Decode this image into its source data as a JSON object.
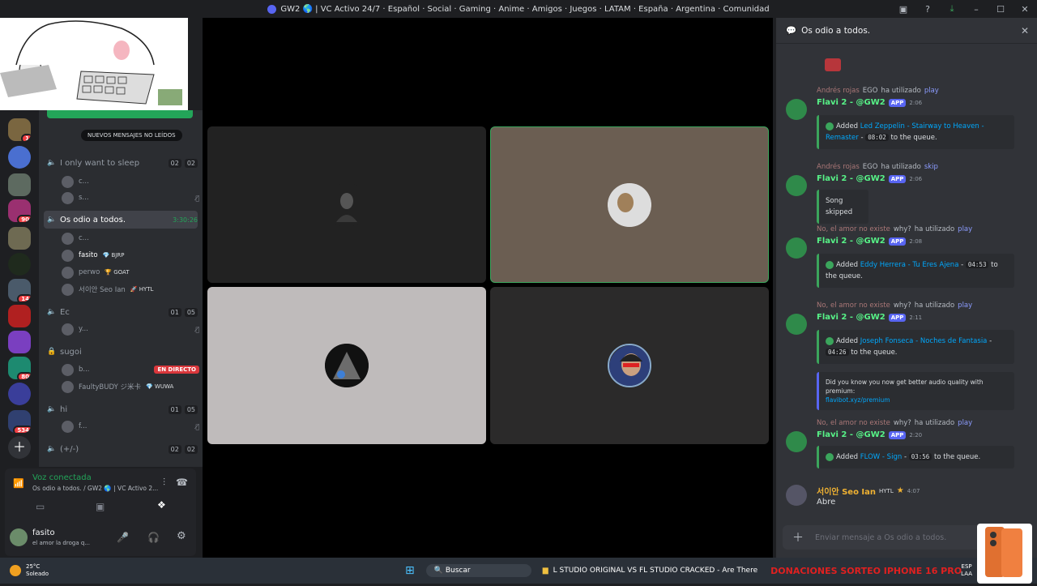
{
  "window": {
    "title": "GW2 🌎 | VC Activo 24/7 · Español · Social · Gaming · Anime · Amigos · Juegos · LATAM · España · Argentina · Comunidad"
  },
  "guild_badges": [
    "1",
    "90",
    "14",
    "80",
    "534"
  ],
  "channels": {
    "new_messages": "NUEVOS MENSAJES NO LEÍDOS",
    "list": [
      {
        "name": "I only want to sleep",
        "count_a": "02",
        "count_b": "02"
      },
      {
        "name": "Os odio a todos.",
        "timer": "3:30:26"
      },
      {
        "name": "Ec",
        "count_a": "01",
        "count_b": "05"
      },
      {
        "name": "sugoi"
      },
      {
        "name": "hi",
        "count_a": "01",
        "count_b": "05"
      },
      {
        "name": "(+/-)",
        "count_a": "02",
        "count_b": "02"
      }
    ],
    "users": [
      {
        "name": "c..."
      },
      {
        "name": "s..."
      },
      {
        "name": "c..."
      },
      {
        "name": "fasito",
        "tag": "💎 BJRP"
      },
      {
        "name": "perwo",
        "tag": "🏆 GOAT"
      },
      {
        "name": "서이안 Seo Ian",
        "tag": "🚀 HYTL"
      },
      {
        "name": "y..."
      },
      {
        "name": "b...",
        "badge": "EN DIRECTO"
      },
      {
        "name": "FaultyBUDY ジ米卡",
        "tag": "💎 WUWA"
      },
      {
        "name": "f..."
      }
    ]
  },
  "voice": {
    "status": "Voz conectada",
    "location": "Os odio a todos. / GW2 🌎 | VC Activo 2..."
  },
  "user_panel": {
    "name": "fasito",
    "status": "el amor la droga q..."
  },
  "chat": {
    "title": "Os odio a todos.",
    "input_placeholder": "Enviar mensaje a Os odio a todos.",
    "messages": [
      {
        "reply_user": "Andrés rojas",
        "reply_tag": "EGO",
        "reply_verb": "ha utilizado",
        "reply_cmd": "play",
        "author": "Flavi 2 - @GW2",
        "app": "APP",
        "time": "2:06",
        "text_pre": "Added",
        "song": "Led Zeppelin - Stairway to Heaven - Remaster",
        "sep": "-",
        "duration": "08:02",
        "text_post": "to the queue."
      },
      {
        "reply_user": "Andrés rojas",
        "reply_tag": "EGO",
        "reply_verb": "ha utilizado",
        "reply_cmd": "skip",
        "author": "Flavi 2 - @GW2",
        "app": "APP",
        "time": "2:06",
        "text": "Song skipped"
      },
      {
        "reply_user": "No, el amor no existe",
        "reply_tag": "why?",
        "reply_verb": "ha utilizado",
        "reply_cmd": "play",
        "author": "Flavi 2 - @GW2",
        "app": "APP",
        "time": "2:08",
        "text_pre": "Added",
        "song": "Eddy Herrera - Tu Eres Ajena",
        "sep": "-",
        "duration": "04:53",
        "text_post": "to the queue."
      },
      {
        "reply_user": "No, el amor no existe",
        "reply_tag": "why?",
        "reply_verb": "ha utilizado",
        "reply_cmd": "play",
        "author": "Flavi 2 - @GW2",
        "app": "APP",
        "time": "2:11",
        "text_pre": "Added",
        "song": "Joseph Fonseca - Noches de Fantasia",
        "sep": "-",
        "duration": "04:26",
        "text_post": "to the queue.",
        "promo": "Did you know you now get better audio quality with premium:",
        "promo_link": "flavibot.xyz/premium"
      },
      {
        "reply_user": "No, el amor no existe",
        "reply_tag": "why?",
        "reply_verb": "ha utilizado",
        "reply_cmd": "play",
        "author": "Flavi 2 - @GW2",
        "app": "APP",
        "time": "2:20",
        "text_pre": "Added",
        "song": "FLOW - Sign",
        "sep": "-",
        "duration": "03:56",
        "text_post": "to the queue."
      },
      {
        "author": "서이안 Seo Ian",
        "tag": "HYTL",
        "time": "4:07",
        "text": "Abre"
      }
    ]
  },
  "taskbar": {
    "weather_temp": "25°C",
    "weather_desc": "Soleado",
    "search": "Buscar",
    "ticker": "L STUDIO ORIGINAL VS FL STUDIO CRACKED - Are There",
    "ticker2": "DONACIONES SORTEO IPHONE 16 PRO",
    "lang": "ESP",
    "layout": "LAA"
  }
}
